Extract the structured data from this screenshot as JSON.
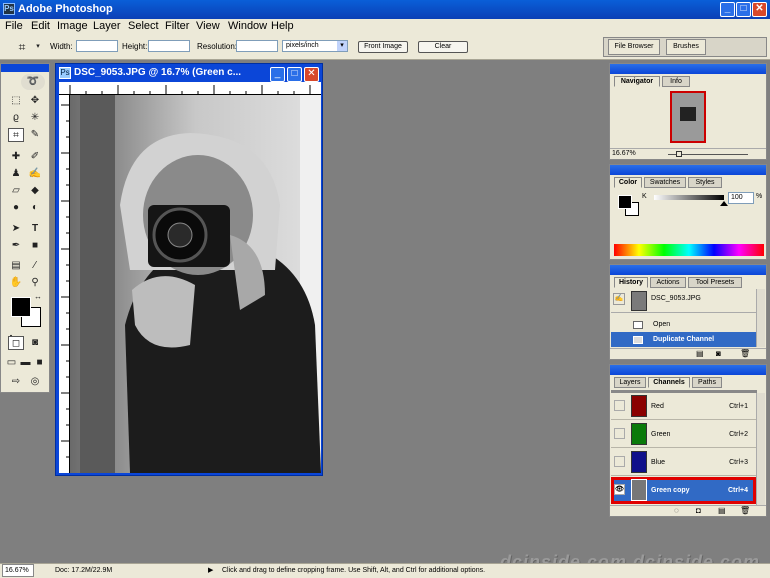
{
  "app": {
    "title": "Adobe Photoshop"
  },
  "menu": [
    "File",
    "Edit",
    "Image",
    "Layer",
    "Select",
    "Filter",
    "View",
    "Window",
    "Help"
  ],
  "options": {
    "width_label": "Width:",
    "height_label": "Height:",
    "resolution_label": "Resolution:",
    "units": "pixels/inch",
    "front_image": "Front Image",
    "clear": "Clear",
    "file_browser": "File Browser",
    "brushes": "Brushes"
  },
  "document": {
    "title": "DSC_9053.JPG @ 16.7% (Green c..."
  },
  "navigator": {
    "tabs": [
      "Navigator",
      "Info"
    ],
    "zoom": "16.67%"
  },
  "color": {
    "tabs": [
      "Color",
      "Swatches",
      "Styles"
    ],
    "channel_label": "K",
    "value": "100",
    "unit": "%"
  },
  "history": {
    "tabs": [
      "History",
      "Actions",
      "Tool Presets"
    ],
    "snapshot": "DSC_9053.JPG",
    "items": [
      "Open",
      "Duplicate Channel"
    ]
  },
  "channels": {
    "tabs": [
      "Layers",
      "Channels",
      "Paths"
    ],
    "rows": [
      {
        "name": "Red",
        "shortcut": "Ctrl+1"
      },
      {
        "name": "Green",
        "shortcut": "Ctrl+2"
      },
      {
        "name": "Blue",
        "shortcut": "Ctrl+3"
      },
      {
        "name": "Green copy",
        "shortcut": "Ctrl+4"
      }
    ]
  },
  "status": {
    "zoom": "16.67%",
    "doc": "Doc: 17.2M/22.9M",
    "hint": "Click and drag to define cropping frame. Use Shift, Alt, and Ctrl for additional options."
  },
  "watermark": "dcinside.com dcinside.com",
  "colors": {
    "selection": "#316ac5",
    "highlight": "#e00000",
    "titlebar": "#0b46d8"
  }
}
